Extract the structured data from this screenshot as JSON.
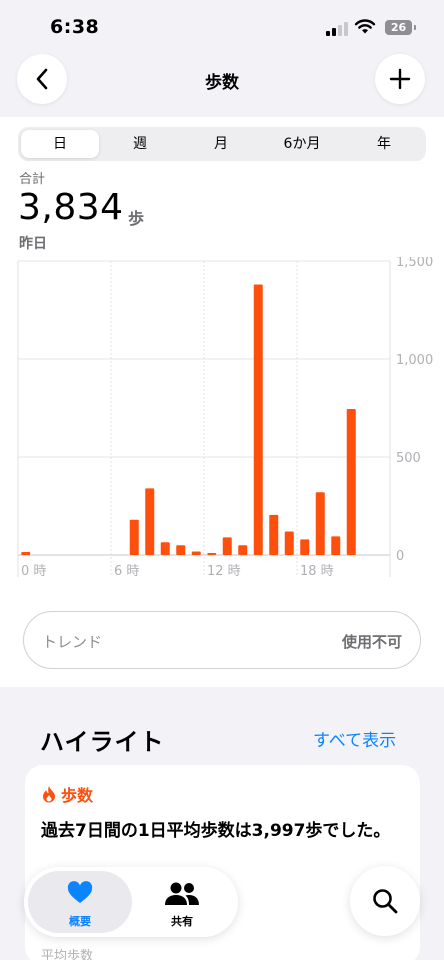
{
  "status_bar": {
    "time": "6:38",
    "battery": "26"
  },
  "nav": {
    "title": "歩数",
    "back_icon": "chevron-left-icon",
    "add_icon": "plus-icon"
  },
  "segments": [
    "日",
    "週",
    "月",
    "6か月",
    "年"
  ],
  "selected_segment": "日",
  "summary": {
    "label": "合計",
    "value": "3,834",
    "unit": "歩",
    "date": "昨日"
  },
  "chart_data": {
    "type": "bar",
    "x": [
      0,
      1,
      2,
      3,
      4,
      5,
      6,
      7,
      8,
      9,
      10,
      11,
      12,
      13,
      14,
      15,
      16,
      17,
      18,
      19,
      20,
      21,
      22,
      23
    ],
    "values": [
      15,
      0,
      0,
      0,
      0,
      0,
      0,
      180,
      340,
      65,
      50,
      18,
      5,
      90,
      50,
      1380,
      205,
      120,
      80,
      320,
      95,
      745,
      0,
      0
    ],
    "x_tick_labels": [
      "0 時",
      "6 時",
      "12 時",
      "18 時"
    ],
    "y_tick_labels": [
      "1,500",
      "1,000",
      "500",
      "0"
    ],
    "ylim": [
      0,
      1500
    ],
    "bar_color": "#ff4f0d",
    "grid": true
  },
  "trend": {
    "label": "トレンド",
    "status": "使用不可"
  },
  "highlights": {
    "title": "ハイライト",
    "show_all": "すべて表示",
    "card": {
      "category": "歩数",
      "text": "過去7日間の1日平均歩数は3,997歩でした。",
      "sub_label": "平均歩数"
    }
  },
  "tabbar": {
    "tabs": [
      {
        "label": "概要",
        "icon": "heart-icon",
        "active": true
      },
      {
        "label": "共有",
        "icon": "people-icon",
        "active": false
      }
    ],
    "search_icon": "search-icon"
  },
  "colors": {
    "accent": "#ff4f0d",
    "link": "#0a84ff"
  }
}
